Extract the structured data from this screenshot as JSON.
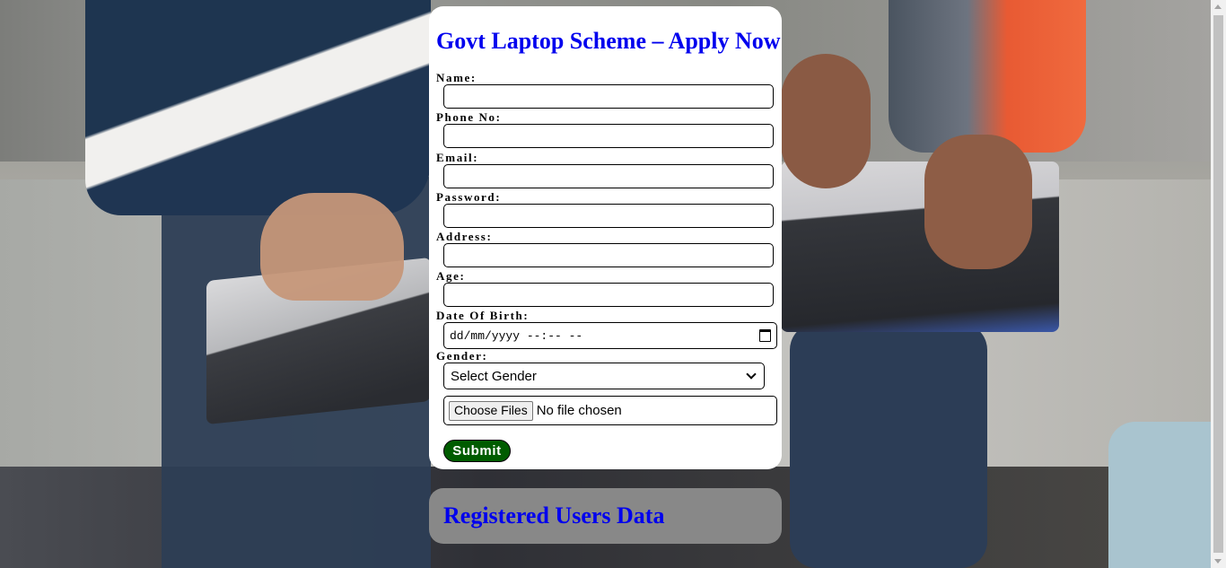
{
  "form": {
    "title": "Govt Laptop Scheme – Apply Now",
    "fields": [
      {
        "label": "Name:",
        "value": ""
      },
      {
        "label": "Phone No:",
        "value": ""
      },
      {
        "label": "Email:",
        "value": ""
      },
      {
        "label": "Password:",
        "value": ""
      },
      {
        "label": "Address:",
        "value": ""
      },
      {
        "label": "Age:",
        "value": ""
      }
    ],
    "dob": {
      "label": "Date Of Birth:",
      "placeholder": "dd/mm/yyyy --:-- --"
    },
    "gender": {
      "label": "Gender:",
      "selected": "Select Gender"
    },
    "file": {
      "button_label": "Choose Files",
      "status": "No file chosen"
    },
    "submit_label": "Submit"
  },
  "users_section": {
    "title": "Registered Users Data"
  },
  "icons": {
    "calendar": "calendar-icon",
    "dropdown": "chevron-down-icon"
  },
  "colors": {
    "title": "#0000ee",
    "submit_bg": "#005c00",
    "users_card_bg": "#888888"
  }
}
